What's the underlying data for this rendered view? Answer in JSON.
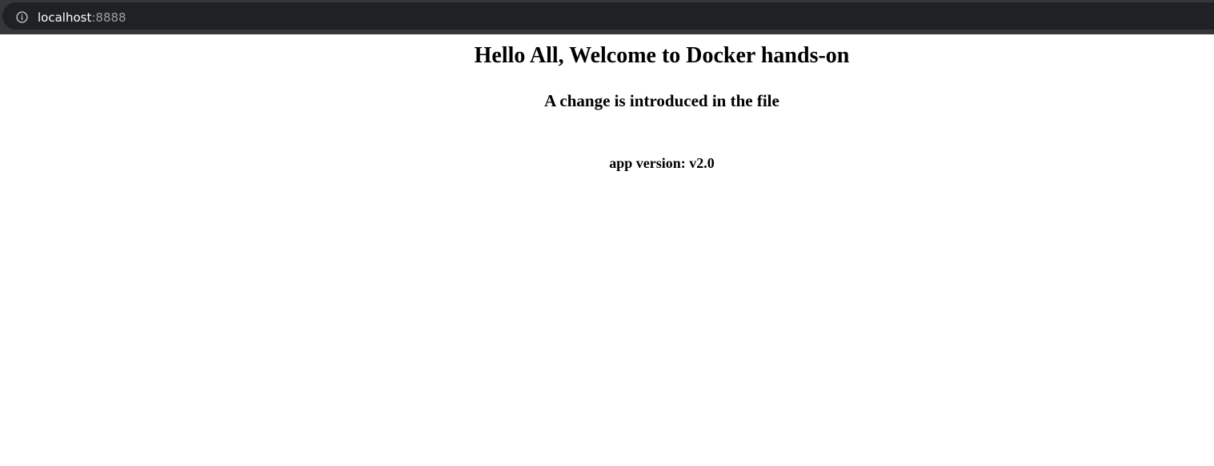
{
  "browser": {
    "url_host": "localhost",
    "url_port": ":8888",
    "info_icon": "info-icon"
  },
  "page": {
    "heading": "Hello All, Welcome to Docker hands-on",
    "subheading": "A change is introduced in the file",
    "version_text": "app version: v2.0"
  }
}
